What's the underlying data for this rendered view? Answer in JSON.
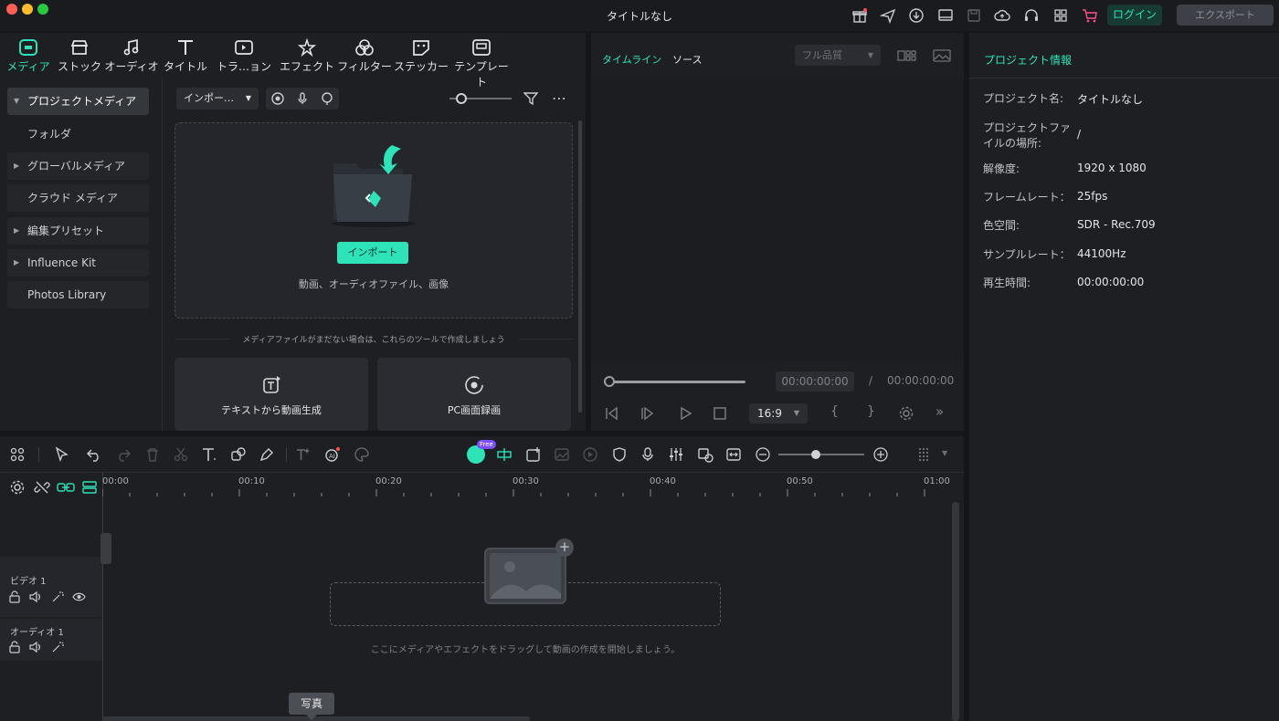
{
  "window": {
    "title": "タイトルなし"
  },
  "header": {
    "login_label": "ログイン",
    "export_label": "エクスポート"
  },
  "colors": {
    "accent": "#2ee3b8",
    "background": "#1d1f23"
  },
  "tabs": [
    {
      "label": "メディア",
      "icon": "media-icon",
      "active": true
    },
    {
      "label": "ストック",
      "icon": "stock-icon"
    },
    {
      "label": "オーディオ",
      "icon": "audio-icon"
    },
    {
      "label": "タイトル",
      "icon": "title-icon"
    },
    {
      "label": "トラ…ョン",
      "icon": "transition-icon"
    },
    {
      "label": "エフェクト",
      "icon": "effect-icon"
    },
    {
      "label": "フィルター",
      "icon": "filter-icon"
    },
    {
      "label": "ステッカー",
      "icon": "sticker-icon"
    },
    {
      "label": "テンプレート",
      "icon": "template-icon"
    }
  ],
  "sidebar": {
    "items": [
      {
        "label": "プロジェクトメディア"
      },
      {
        "label": "フォルダ"
      },
      {
        "label": "グローバルメディア"
      },
      {
        "label": "クラウド メディア"
      },
      {
        "label": "編集プリセット"
      },
      {
        "label": "Influence Kit"
      },
      {
        "label": "Photos Library"
      }
    ]
  },
  "media": {
    "import_dropdown": "インポー…",
    "import_button": "インポート",
    "drop_hint": "動画、オーディオファイル、画像",
    "no_media_hint": "メディアファイルがまだない場合は、これらのツールで作成しましょう",
    "tools": [
      {
        "label": "テキストから動画生成"
      },
      {
        "label": "PC画面録画"
      }
    ]
  },
  "preview": {
    "tab_timeline": "タイムライン",
    "tab_source": "ソース",
    "quality": "フル品質",
    "current_time": "00:00:00:00",
    "separator": "/",
    "total_time": "00:00:00:00",
    "aspect": "16:9",
    "brace_open": "{",
    "brace_close": "}"
  },
  "info": {
    "title": "プロジェクト情報",
    "rows": [
      {
        "label": "プロジェクト名:",
        "value": "タイトルなし"
      },
      {
        "label": "プロジェクトファイルの場所:",
        "value": "/"
      },
      {
        "label": "解像度:",
        "value": "1920 x 1080"
      },
      {
        "label": "フレームレート：",
        "value": "25fps"
      },
      {
        "label": "色空間:",
        "value": "SDR - Rec.709"
      },
      {
        "label": "サンプルレート：",
        "value": "44100Hz"
      },
      {
        "label": "再生時間:",
        "value": "00:00:00:00"
      }
    ]
  },
  "timeline": {
    "ruler": [
      "00:00",
      "00:10",
      "00:20",
      "00:30",
      "00:40",
      "00:50",
      "01:00"
    ],
    "free_badge": "Free",
    "tracks": [
      {
        "label": "ビデオ 1"
      },
      {
        "label": "オーディオ 1"
      }
    ],
    "drop_hint": "ここにメディアやエフェクトをドラッグして動画の作成を開始しましょう。",
    "tooltip": "写真"
  }
}
